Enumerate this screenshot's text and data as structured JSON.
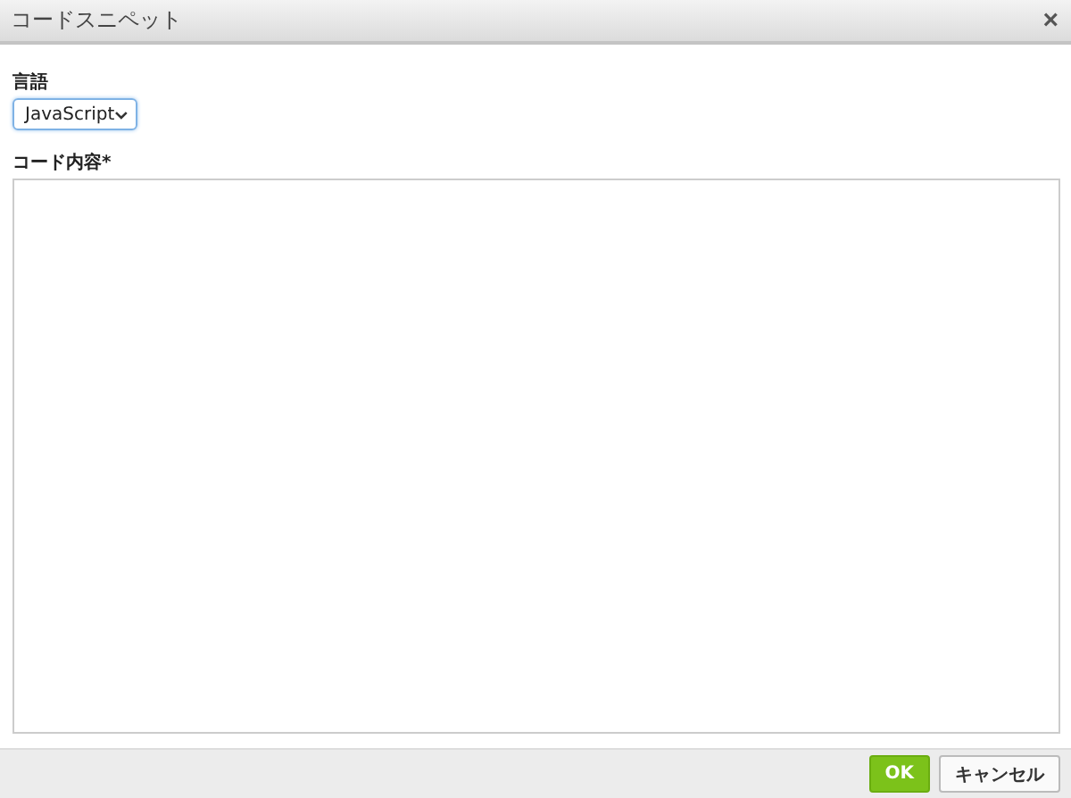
{
  "dialog": {
    "title": "コードスニペット",
    "close": "×"
  },
  "language": {
    "label": "言語",
    "value": "JavaScript"
  },
  "code": {
    "label": "コード内容*"
  },
  "buttons": [
    {
      "label": "OK",
      "kind": "primary"
    },
    {
      "label": "キャンセル",
      "kind": "secondary"
    }
  ]
}
